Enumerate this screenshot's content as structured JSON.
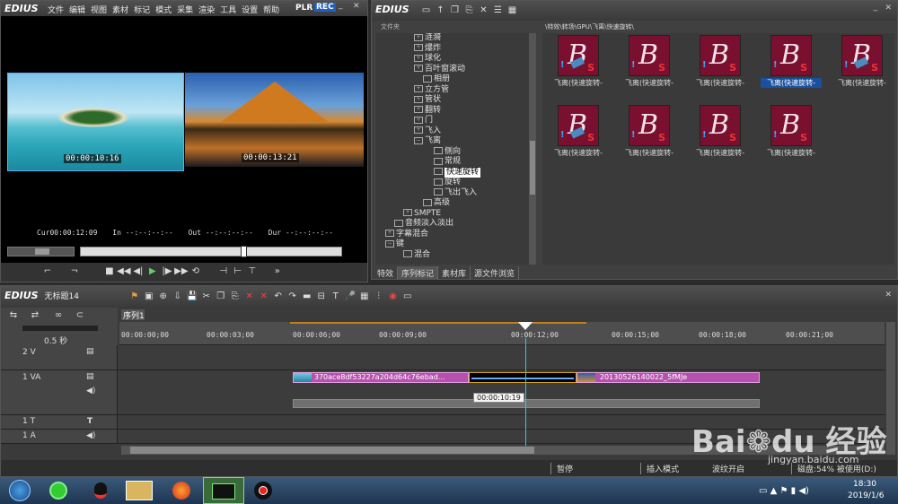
{
  "player": {
    "logo": "EDIUS",
    "menu": [
      "文件",
      "编辑",
      "视图",
      "素材",
      "标记",
      "模式",
      "采集",
      "渲染",
      "工具",
      "设置",
      "帮助"
    ],
    "plr": "PLR",
    "rec": "REC",
    "tc1": "00:00:10:16",
    "tc2": "00:00:13:21",
    "cur_label": "Cur",
    "cur": "00:00:12:09",
    "in_label": "In",
    "in": "--:--:--:--",
    "out_label": "Out",
    "out": "--:--:--:--",
    "dur_label": "Dur",
    "dur": "--:--:--:--"
  },
  "bin": {
    "logo": "EDIUS",
    "folder_header": "文件夹",
    "path": "\\特效\\转场\\GPU\\飞离\\快速旋转\\",
    "tree": [
      "涟漪",
      "爆炸",
      "球化",
      "百叶窗滚动",
      "相册",
      "立方管",
      "管状",
      "翻转",
      "门",
      "飞入",
      "飞离",
      "侧向",
      "常规",
      "快速旋转",
      "旋转",
      "飞出飞入",
      "高级",
      "SMPTE",
      "音频淡入淡出",
      "字幕混合",
      "键",
      "混合"
    ],
    "thumbs": [
      "飞离(快速旋转-",
      "飞离(快速旋转-",
      "飞离(快速旋转-",
      "飞离(快速旋转-",
      "飞离(快速旋转-",
      "飞离(快速旋转-",
      "飞离(快速旋转-",
      "飞离(快速旋转-",
      "飞离(快速旋转-"
    ],
    "tabs": [
      "特效",
      "序列标记",
      "素材库",
      "源文件浏览"
    ]
  },
  "timeline": {
    "logo": "EDIUS",
    "project": "无标题14",
    "seq_tab": "序列1",
    "zoom": "0.5 秒",
    "ruler": [
      "00:00:00;00",
      "00:00:03;00",
      "00:00:06;00",
      "00:00:09;00",
      "00:00:12;00",
      "00:00:15;00",
      "00:00:18;00",
      "00:00:21;00"
    ],
    "tracks": [
      {
        "name": "2 V"
      },
      {
        "name": "1 VA"
      },
      {
        "name": "1 T"
      },
      {
        "name": "1 A"
      }
    ],
    "clip1": "370ace8df53227a204d64c76ebad...",
    "clip2": "20130526140022_5fMJe",
    "tooltip": "00:00:10:19",
    "status": [
      "暂停",
      "插入模式",
      "波纹开启",
      "磁盘:54% 被使用(D:)"
    ]
  },
  "taskbar": {
    "time": "18:30",
    "date": "2019/1/6"
  },
  "watermark": {
    "site": "jingyan.baidu.com"
  }
}
